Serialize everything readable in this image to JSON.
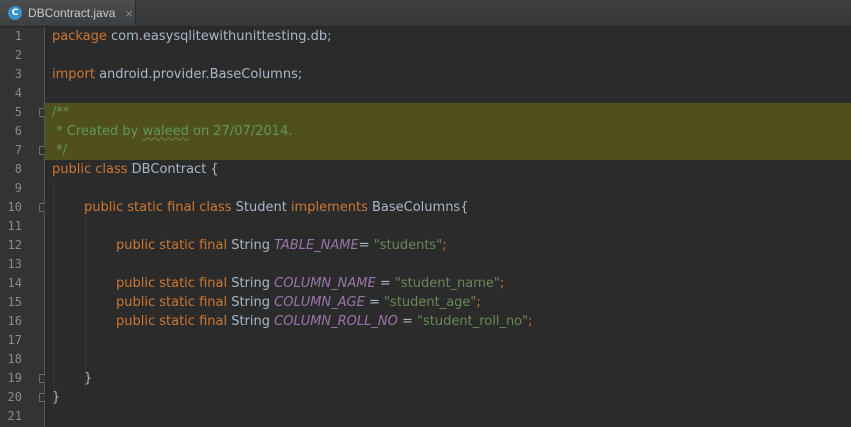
{
  "tab": {
    "icon_letter": "C",
    "title": "DBContract.java",
    "close": "×"
  },
  "line_numbers": [
    "1",
    "2",
    "3",
    "4",
    "5",
    "6",
    "7",
    "8",
    "9",
    "10",
    "11",
    "12",
    "13",
    "14",
    "15",
    "16",
    "17",
    "18",
    "19",
    "20",
    "21"
  ],
  "code": {
    "l1": {
      "kw": "package",
      "rest": " com.easysqlitewithunittesting.db;"
    },
    "l3": {
      "kw": "import",
      "rest": " android.provider.BaseColumns;"
    },
    "l5": {
      "text": "/**"
    },
    "l6": {
      "pre": " * Created by ",
      "author": "waleed",
      "post": " on 27/07/2014."
    },
    "l7": {
      "text": " */"
    },
    "l8": {
      "kw": "public class",
      "rest": " DBContract {"
    },
    "l10": {
      "kw": "public static final class",
      "name": " Student ",
      "kw2": "implements",
      "rest": " BaseColumns{"
    },
    "l12": {
      "kw": "public static final",
      "type": " String ",
      "const": "TABLE_NAME",
      "eq": "= ",
      "str": "\"students\"",
      "end": ";"
    },
    "l14": {
      "kw": "public static final",
      "type": " String ",
      "const": "COLUMN_NAME",
      "eq": " = ",
      "str": "\"student_name\"",
      "end": ";"
    },
    "l15": {
      "kw": "public static final",
      "type": " String ",
      "const": "COLUMN_AGE",
      "eq": " = ",
      "str": "\"student_age\"",
      "end": ";"
    },
    "l16": {
      "kw": "public static final",
      "type": " String ",
      "const": "COLUMN_ROLL_NO",
      "eq": " = ",
      "str": "\"student_roll_no\"",
      "end": ";"
    },
    "l19": {
      "text": "}"
    },
    "l20": {
      "text": "}"
    }
  },
  "colors": {
    "background": "#2b2b2b",
    "keyword": "#cc7832",
    "comment": "#629755",
    "string": "#6a8759",
    "constant": "#9876aa",
    "plain": "#a9b7c6",
    "highlight": "#50501f"
  }
}
